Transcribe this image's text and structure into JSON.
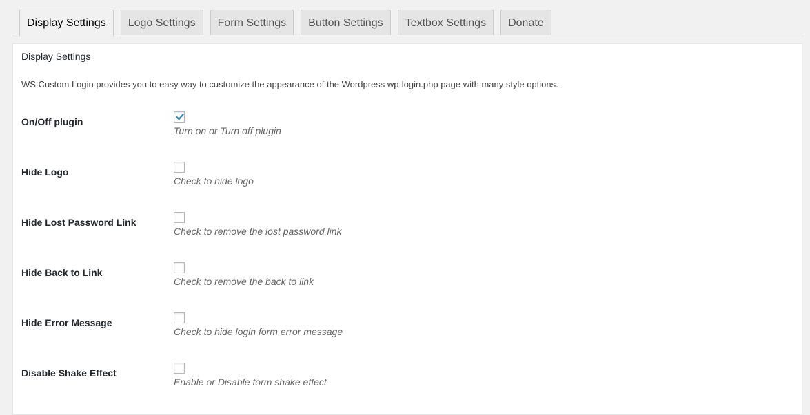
{
  "tabs": [
    {
      "label": "Display Settings",
      "active": true
    },
    {
      "label": "Logo Settings",
      "active": false
    },
    {
      "label": "Form Settings",
      "active": false
    },
    {
      "label": "Button Settings",
      "active": false
    },
    {
      "label": "Textbox Settings",
      "active": false
    },
    {
      "label": "Donate",
      "active": false
    }
  ],
  "panel": {
    "title": "Display Settings",
    "description": "WS Custom Login provides you to easy way to customize the appearance of the Wordpress wp-login.php page with many style options."
  },
  "settings": [
    {
      "label": "On/Off plugin",
      "checked": true,
      "description": "Turn on or Turn off plugin"
    },
    {
      "label": "Hide Logo",
      "checked": false,
      "description": "Check to hide logo"
    },
    {
      "label": "Hide Lost Password Link",
      "checked": false,
      "description": "Check to remove the lost password link"
    },
    {
      "label": "Hide Back to Link",
      "checked": false,
      "description": "Check to remove the back to link"
    },
    {
      "label": "Hide Error Message",
      "checked": false,
      "description": "Check to hide login form error message"
    },
    {
      "label": "Disable Shake Effect",
      "checked": false,
      "description": "Enable or Disable form shake effect"
    }
  ],
  "colors": {
    "check": "#1e8cbe",
    "tab_active_bg": "#f1f1f1",
    "tab_inactive_bg": "#e5e5e5"
  }
}
